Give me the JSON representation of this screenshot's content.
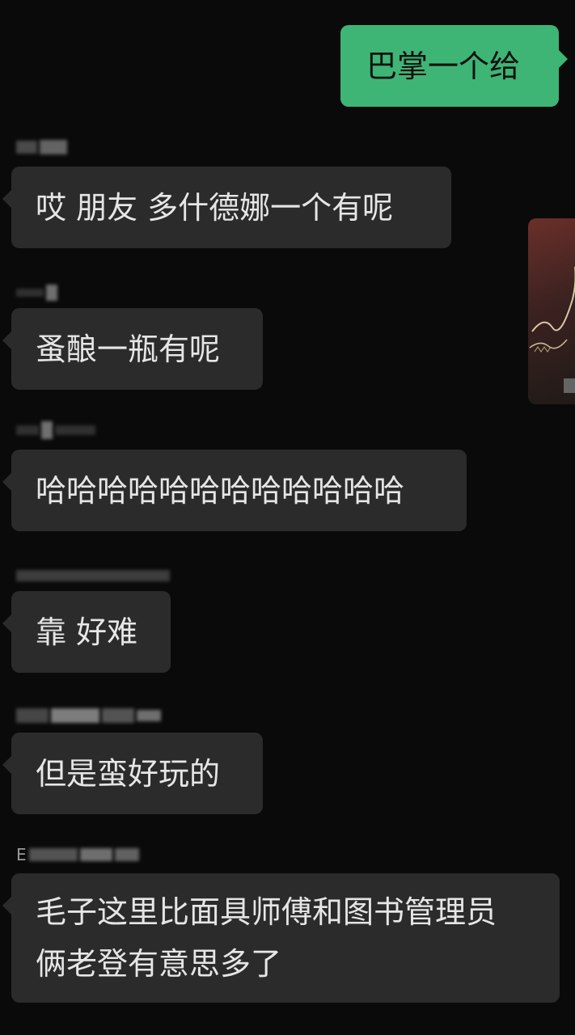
{
  "colors": {
    "background": "#0a0a0a",
    "incoming_bubble": "#2b2b2b",
    "outgoing_bubble": "#3eb575",
    "incoming_text": "#e6e6e6",
    "outgoing_text": "#111111"
  },
  "messages": [
    {
      "direction": "outgoing",
      "text": "巴掌一个给"
    },
    {
      "direction": "incoming",
      "text": "哎 朋友 多什德娜一个有呢"
    },
    {
      "direction": "incoming",
      "text": "蚤酿一瓶有呢"
    },
    {
      "direction": "incoming",
      "text": "哈哈哈哈哈哈哈哈哈哈哈哈"
    },
    {
      "direction": "incoming",
      "text": "靠 好难"
    },
    {
      "direction": "incoming",
      "text": "但是蛮好玩的"
    },
    {
      "direction": "incoming",
      "text_line1": "毛子这里比面具师傅和图书管理员",
      "text_line2": "俩老登有意思多了"
    }
  ],
  "senders": {
    "msg1": "",
    "msg4": "",
    "msg7": "E"
  },
  "thumbnail": {
    "icon": "image-thumbnail"
  }
}
